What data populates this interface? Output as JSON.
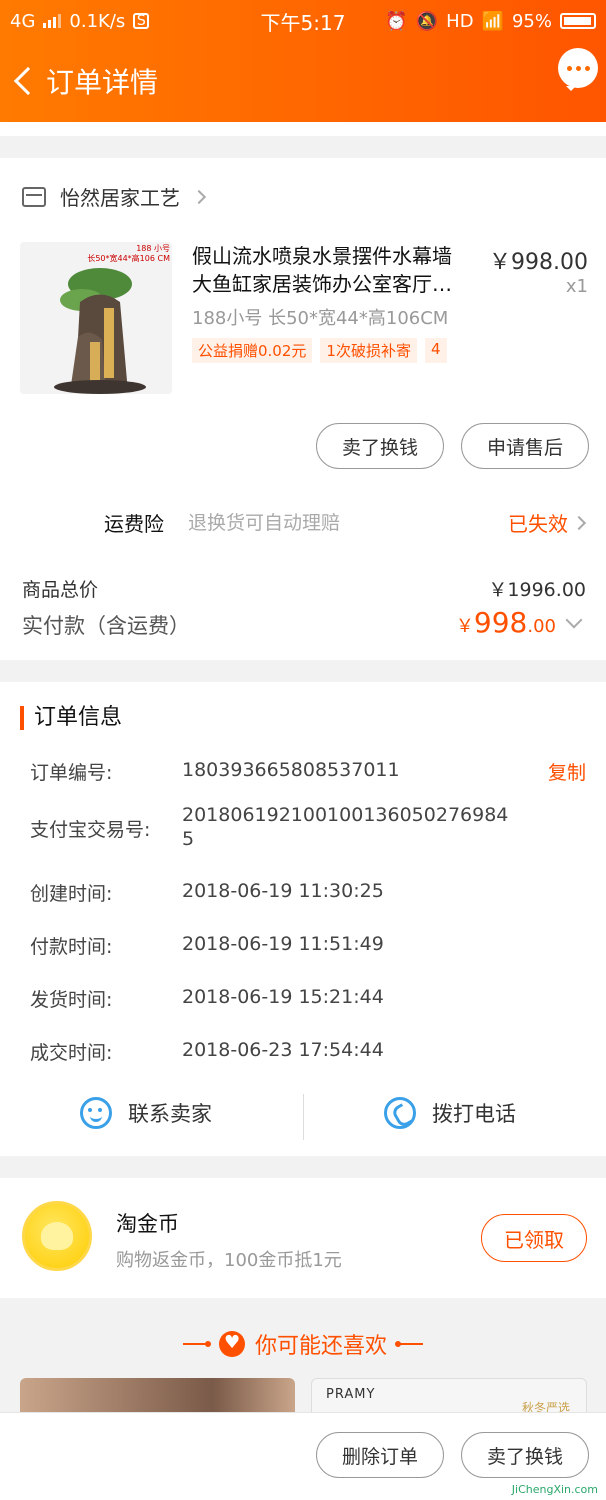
{
  "status_bar": {
    "network": "4G",
    "speed": "0.1K/s",
    "time": "下午5:17",
    "hd": "HD",
    "battery": "95%"
  },
  "nav": {
    "title": "订单详情"
  },
  "shop": {
    "name": "怡然居家工艺"
  },
  "product": {
    "thumb_tag_1": "188 小号",
    "thumb_tag_2": "长50*宽44*高106 CM",
    "name_line1": "假山流水喷泉水景摆件水幕墙",
    "name_line2": "大鱼缸家居装饰办公室客厅…",
    "price": "￥998.00",
    "qty": "x1",
    "sku": "188小号 长50*宽44*高106CM",
    "tags": [
      "公益捐赠0.02元",
      "1次破损补寄",
      "4"
    ]
  },
  "item_actions": {
    "sell": "卖了换钱",
    "after_sale": "申请售后"
  },
  "insurance": {
    "label": "运费险",
    "desc": "退换货可自动理赔",
    "status": "已失效"
  },
  "summary": {
    "total_label": "商品总价",
    "total_value": "￥1996.00",
    "paid_label": "实付款（含运费）",
    "paid_symbol": "￥",
    "paid_int": "998",
    "paid_dec": ".00"
  },
  "order_info": {
    "title": "订单信息",
    "copy": "复制",
    "rows": [
      {
        "k": "订单编号:",
        "v": "180393665808537011"
      },
      {
        "k": "支付宝交易号:",
        "v1": "2018061921001001360502769845",
        "v1a": "201806192100100136050276984",
        "v1b": "5"
      },
      {
        "k": "创建时间:",
        "v": "2018-06-19 11:30:25"
      },
      {
        "k": "付款时间:",
        "v": "2018-06-19 11:51:49"
      },
      {
        "k": "发货时间:",
        "v": "2018-06-19 15:21:44"
      },
      {
        "k": "成交时间:",
        "v": "2018-06-23 17:54:44"
      }
    ]
  },
  "contact": {
    "seller": "联系卖家",
    "call": "拨打电话"
  },
  "coins": {
    "title": "淘金币",
    "desc": "购物返金币，100金币抵1元",
    "button": "已领取"
  },
  "recommend": {
    "title": "你可能还喜欢",
    "card2_brand": "PRAMY",
    "card2_promo": "秋冬严选"
  },
  "bottom_actions": {
    "delete": "删除订单",
    "sell": "卖了换钱"
  },
  "watermark": "JiChengXin.com",
  "colors": {
    "accent": "#ff5000",
    "header_start": "#ff7a00",
    "header_end": "#ff5500",
    "link_blue": "#3aa0e8"
  }
}
